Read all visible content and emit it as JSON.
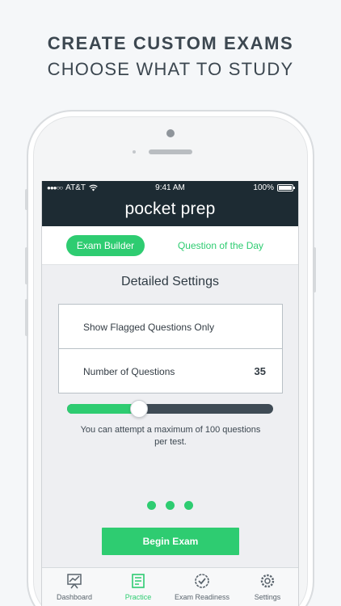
{
  "headline": {
    "line1": "CREATE CUSTOM EXAMS",
    "line2": "CHOOSE WHAT TO STUDY"
  },
  "status_bar": {
    "signal": "●●●○○",
    "carrier": "AT&T",
    "time": "9:41 AM",
    "battery": "100%",
    "battery_level": 1.0
  },
  "app": {
    "title": "pocket prep"
  },
  "tabs": {
    "active": "Exam Builder",
    "inactive": "Question of the Day"
  },
  "settings": {
    "title": "Detailed Settings",
    "rows": [
      {
        "label": "Show Flagged Questions Only",
        "value": ""
      },
      {
        "label": "Number of Questions",
        "value": "35"
      }
    ]
  },
  "slider": {
    "value": 35,
    "max": 100
  },
  "hint": "You can attempt a maximum of 100 questions per test.",
  "page_dots": 3,
  "begin_button": "Begin Exam",
  "tab_bar": [
    {
      "label": "Dashboard",
      "icon": "dashboard-chart-icon",
      "active": false
    },
    {
      "label": "Practice",
      "icon": "practice-notepad-icon",
      "active": true
    },
    {
      "label": "Exam Readiness",
      "icon": "exam-readiness-check-icon",
      "active": false
    },
    {
      "label": "Settings",
      "icon": "settings-gear-icon",
      "active": false
    }
  ],
  "colors": {
    "accent": "#2ecc71",
    "header": "#1d2b33",
    "slider_track": "#3f4b55"
  }
}
